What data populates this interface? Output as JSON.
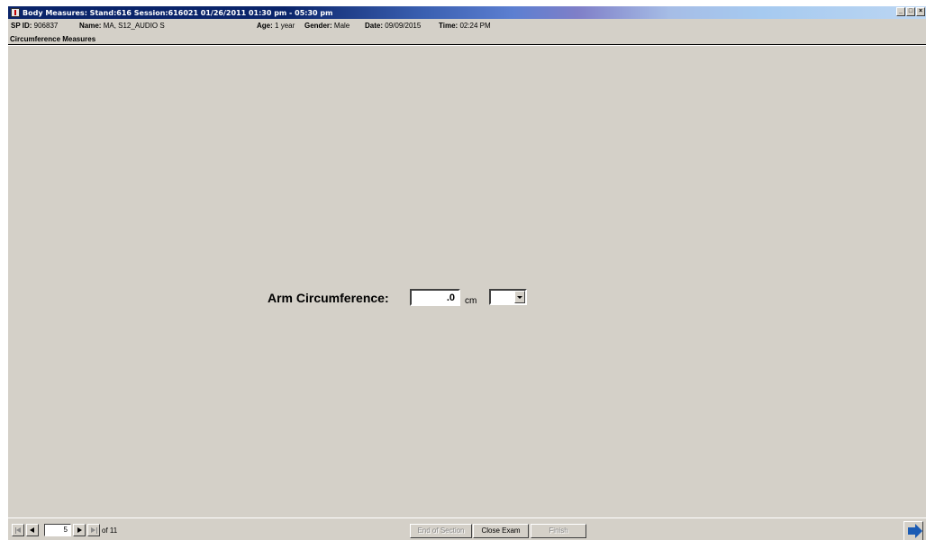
{
  "window": {
    "title": "Body Measures: Stand:616 Session:616021 01/26/2011 01:30 pm - 05:30 pm",
    "minimize": "_",
    "maximize": "□",
    "close": "×"
  },
  "info": {
    "sp_id_label": "SP ID:",
    "sp_id_value": "906837",
    "name_label": "Name:",
    "name_value": "MA, S12_AUDIO S",
    "age_label": "Age:",
    "age_value": "1 year",
    "gender_label": "Gender:",
    "gender_value": "Male",
    "date_label": "Date:",
    "date_value": "09/09/2015",
    "time_label": "Time:",
    "time_value": "02:24 PM"
  },
  "section": {
    "title": "Circumference Measures"
  },
  "form": {
    "arm_label": "Arm Circumference:",
    "arm_value": ".0",
    "unit": "cm",
    "select_value": ""
  },
  "navigation": {
    "page_value": "5",
    "page_of": "of 11"
  },
  "actions": {
    "end_of_section": "End of Section",
    "close_exam": "Close Exam",
    "finish": "Finish"
  },
  "colors": {
    "window_bg": "#d4d0c8",
    "title_start": "#0a246a",
    "title_end": "#bcd6f2",
    "next_arrow": "#1a5bb4"
  }
}
